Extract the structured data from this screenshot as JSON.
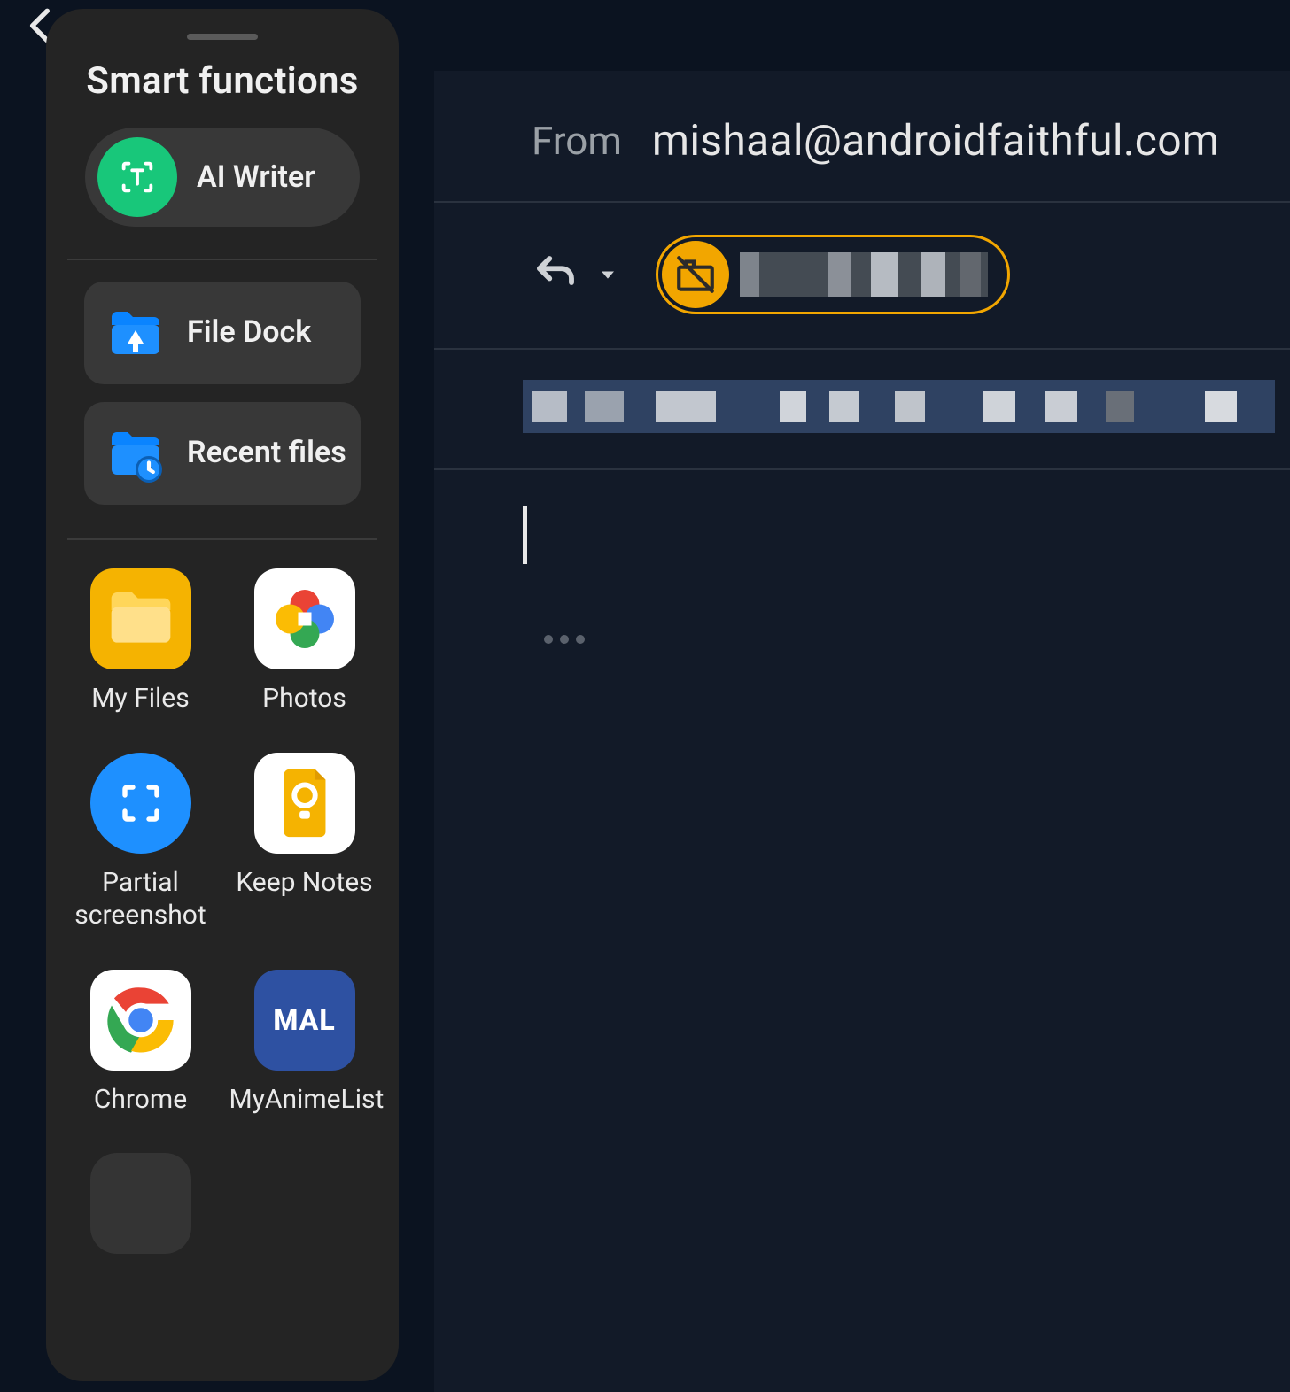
{
  "panel": {
    "title": "Smart functions",
    "ai_writer_label": "AI Writer",
    "file_dock_label": "File Dock",
    "recent_files_label": "Recent files",
    "apps": {
      "my_files": "My Files",
      "photos": "Photos",
      "partial_screenshot": "Partial screenshot",
      "keep_notes": "Keep Notes",
      "chrome": "Chrome",
      "myanimelist": "MyAnimeList"
    }
  },
  "email": {
    "from_label": "From",
    "from_value": "mishaal@androidfaithful.com"
  }
}
